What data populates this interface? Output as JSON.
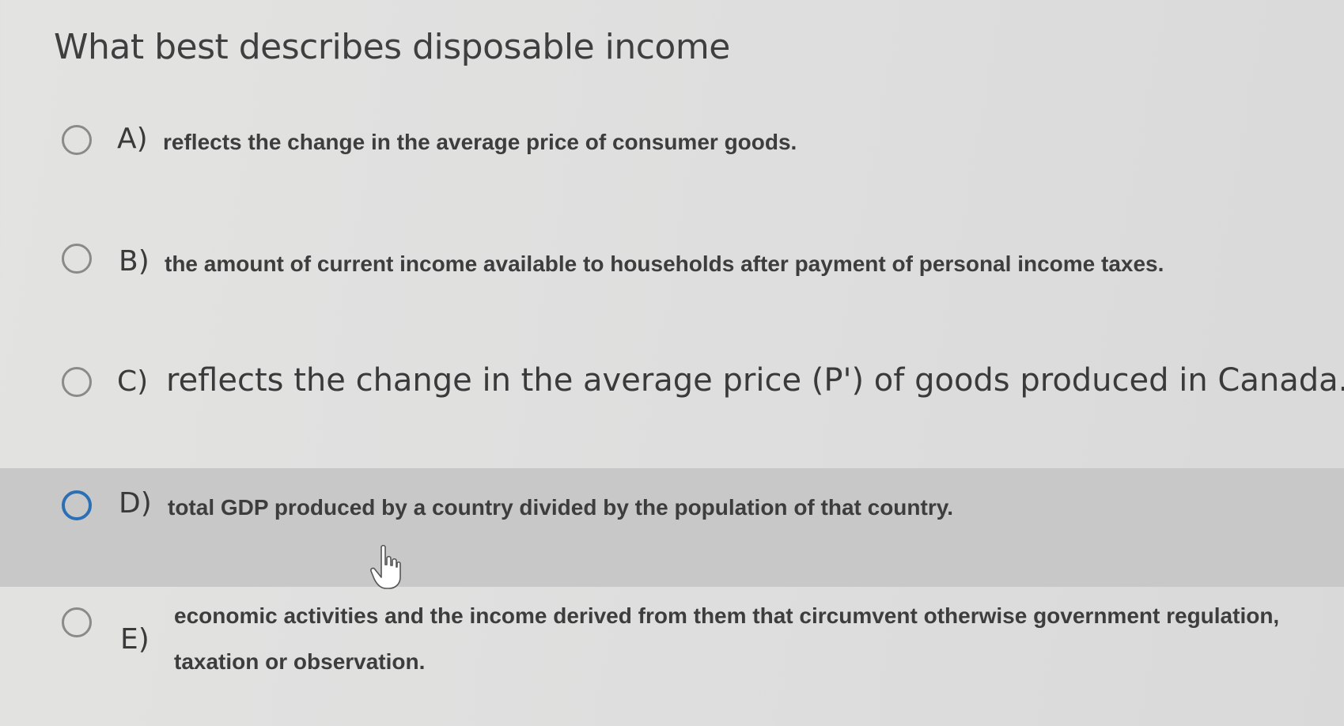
{
  "question": "What best describes disposable income",
  "options": [
    {
      "letter": "A)",
      "text": "reflects the change in the average price of consumer goods."
    },
    {
      "letter": "B)",
      "text": "the amount of current income available to households after payment of personal income taxes."
    },
    {
      "letter": "C)",
      "text": "reflects the change in the average price (P') of goods produced in Canada."
    },
    {
      "letter": "D)",
      "text": "total GDP produced by a country divided by the population of that country."
    },
    {
      "letter": "E)",
      "text": "economic activities and the income derived from them that circumvent otherwise government regulation, taxation or observation."
    }
  ],
  "icons": {
    "cursor": "hand-pointer-icon"
  },
  "colors": {
    "hover_row": "#c8c8c8",
    "focus_ring": "#2b6fb5"
  }
}
